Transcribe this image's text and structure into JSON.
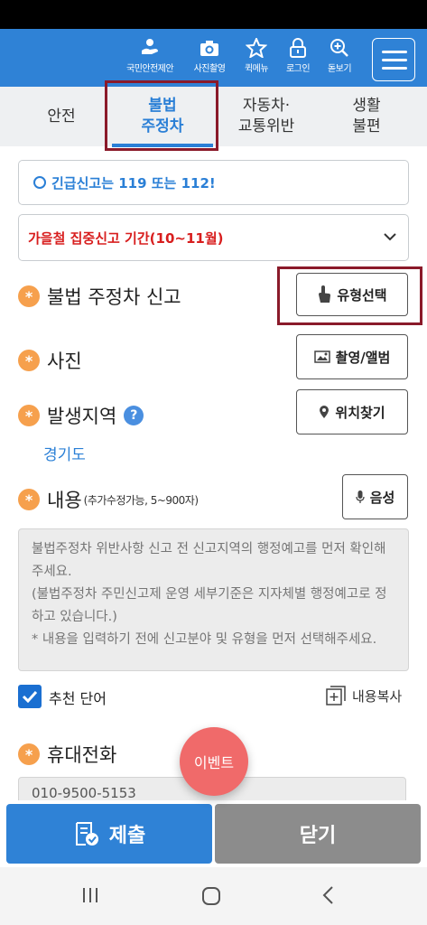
{
  "header": {
    "items": [
      {
        "label": "국민안전제안",
        "icon": "safety-proposal-icon"
      },
      {
        "label": "사진촬영",
        "icon": "camera-icon"
      },
      {
        "label": "퀵메뉴",
        "icon": "star-icon"
      },
      {
        "label": "로그인",
        "icon": "lock-icon"
      },
      {
        "label": "돋보기",
        "icon": "magnifier-plus-icon"
      }
    ],
    "menu_icon": "hamburger-menu-icon"
  },
  "tabs": [
    {
      "line1": "안전",
      "line2": ""
    },
    {
      "line1": "불법",
      "line2": "주정차",
      "active": true
    },
    {
      "line1": "자동차·",
      "line2": "교통위반"
    },
    {
      "line1": "생활",
      "line2": "불편"
    }
  ],
  "notice": {
    "text": "긴급신고는 119 또는 112!"
  },
  "campaign_select": {
    "selected": "가을철 집중신고 기간(10~11월)"
  },
  "fields": {
    "report_type": {
      "label": "불법 주정차 신고",
      "button": "유형선택"
    },
    "photo": {
      "label": "사진",
      "button": "촬영/앨범"
    },
    "location": {
      "label": "발생지역",
      "help": "?",
      "button": "위치찾기",
      "value": "경기도"
    },
    "content": {
      "label": "내용",
      "sub": "(추가수정가능, 5~900자)",
      "voice_button": "음성",
      "placeholder": "불법주정차 위반사항 신고 전 신고지역의 행정예고를 먼저 확인해주세요.\n(불법주정차 주민신고제 운영 세부기준은 지자체별 행정예고로 정하고 있습니다.)\n* 내용을 입력하기 전에 신고분야 및 유형을 먼저 선택해주세요."
    },
    "recommend": {
      "label": "추천 단어",
      "checked": true
    },
    "copy": {
      "label": "내용복사"
    },
    "phone": {
      "label": "휴대전화",
      "value": "010-9500-5153"
    }
  },
  "event_button": "이벤트",
  "actions": {
    "submit": "제출",
    "close": "닫기"
  },
  "colors": {
    "primary": "#2f82d6",
    "accent": "#f6a04d",
    "alert": "#d81e1e",
    "event": "#f06a6a",
    "highlight": "#8a1a2a"
  }
}
